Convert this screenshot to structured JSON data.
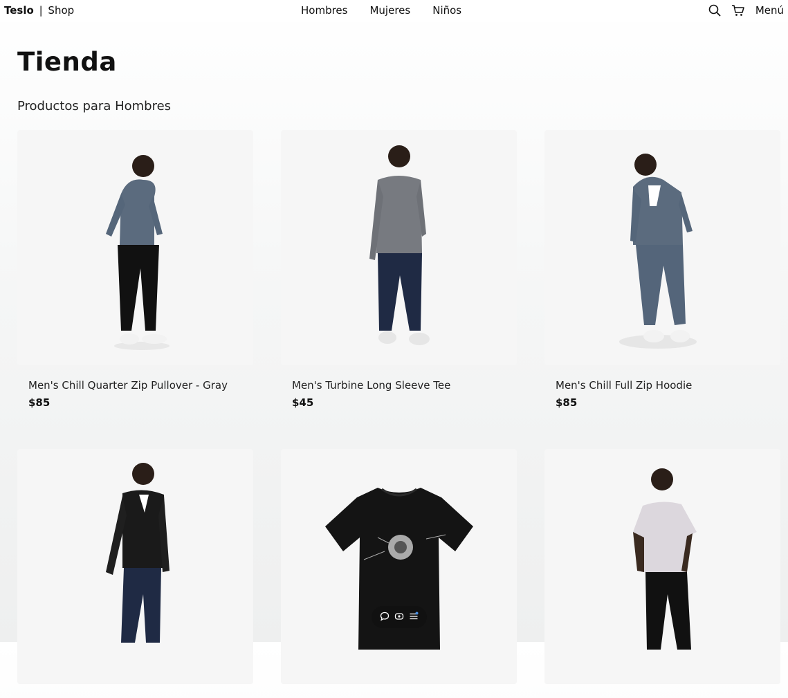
{
  "header": {
    "brand_bold": "Teslo",
    "brand_sep": "|",
    "brand_rest": "Shop",
    "nav": [
      "Hombres",
      "Mujeres",
      "Niños"
    ],
    "icons": [
      "search-icon",
      "cart-icon"
    ],
    "menu_label": "Menú"
  },
  "main": {
    "title": "Tienda",
    "subtitle": "Productos para Hombres",
    "products": [
      {
        "name": "Men's Chill Quarter Zip Pullover - Gray",
        "price": "$85"
      },
      {
        "name": "Men's Turbine Long Sleeve Tee",
        "price": "$45"
      },
      {
        "name": "Men's Chill Full Zip Hoodie",
        "price": "$85"
      },
      {
        "name": "",
        "price": ""
      },
      {
        "name": "",
        "price": ""
      },
      {
        "name": "",
        "price": ""
      }
    ]
  },
  "floating_toolbar": {
    "icons": [
      "comment-icon",
      "eye-icon",
      "menu-lines-icon"
    ]
  },
  "colors": {
    "text": "#111111",
    "card_bg": "#f6f6f6",
    "toolbar_bg": "#111111",
    "toolbar_accent": "#4a90e2"
  }
}
